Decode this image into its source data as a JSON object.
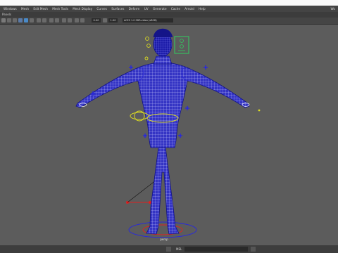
{
  "menubar": {
    "items": [
      "Windows",
      "Mesh",
      "Edit Mesh",
      "Mesh Tools",
      "Mesh Display",
      "Curves",
      "Surfaces",
      "Deform",
      "UV",
      "Generate",
      "Cache",
      "Arnold",
      "Help"
    ],
    "workspace": "Wo"
  },
  "panel": {
    "label": "Panels"
  },
  "toolbar": {
    "value_a": "0.00",
    "value_b": "1.00",
    "colorspace": "ACES 1.0 SDR-video (sRGB)"
  },
  "viewport": {
    "camera_label": "persp"
  },
  "statusbar": {
    "mel_label": "MEL"
  },
  "colors": {
    "mesh_wire": "#1a1acc",
    "control_blue": "#2a2ad8",
    "control_yellow": "#dddd22",
    "control_green": "#30d060",
    "root_red": "#e02020",
    "viewport_bg": "#5c5c5c"
  }
}
